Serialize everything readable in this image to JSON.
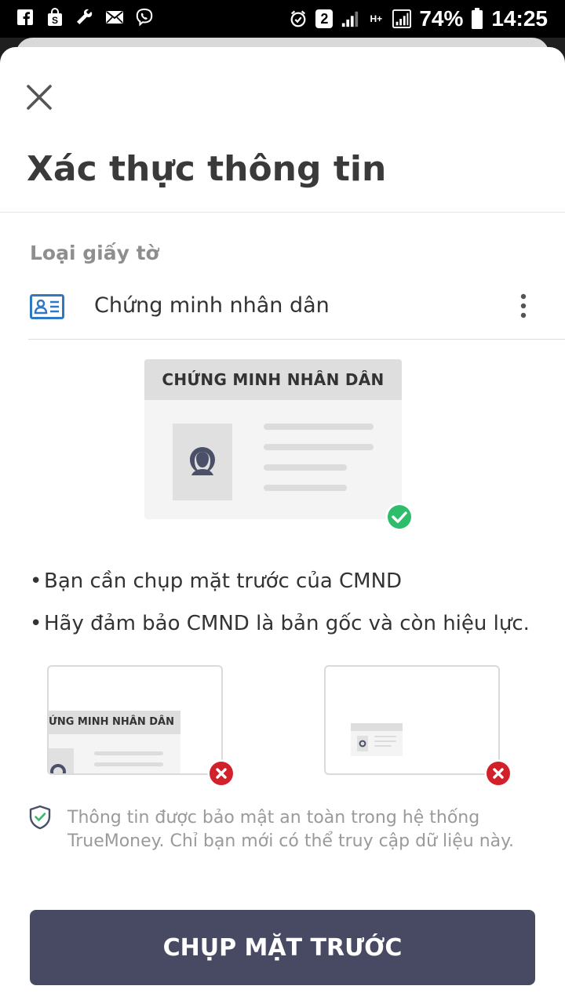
{
  "status_bar": {
    "left_icons": [
      "facebook-icon",
      "shopping-bag-icon",
      "wrench-icon",
      "mail-icon",
      "viber-icon"
    ],
    "sim_badge": "2",
    "network": "H+",
    "battery": "74%",
    "time": "14:25"
  },
  "header": {
    "title": "Xác thực thông tin",
    "close_icon": "close-icon"
  },
  "document": {
    "label": "Loại giấy tờ",
    "selected": "Chứng minh nhân dân"
  },
  "illustration": {
    "card_title": "CHỨNG MINH NHÂN DÂN",
    "bad_example_1_title": "ỨNG MINH NHÂN DÂN"
  },
  "instructions": [
    "Bạn cần chụp mặt trước của CMND",
    "Hãy đảm bảo CMND là bản gốc và còn hiệu lực."
  ],
  "security": {
    "text": "Thông tin được bảo mật an toàn trong hệ thống TrueMoney. Chỉ bạn mới có thể truy cập dữ liệu này."
  },
  "cta": {
    "label": "CHỤP MẶT TRƯỚC"
  },
  "colors": {
    "primary": "#474a62",
    "success": "#2ebd6b",
    "error": "#d3212c",
    "icon_blue": "#2f78c4"
  }
}
